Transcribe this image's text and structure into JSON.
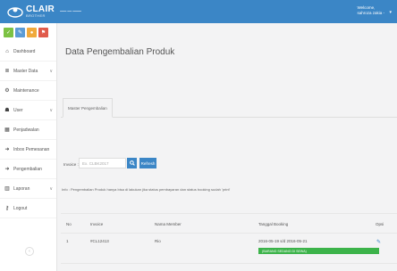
{
  "brand": {
    "name": "CLAIR",
    "sub": "BROTHER",
    "tagline": "━━━ ━━ ━━━━"
  },
  "user": {
    "welcome": "Welcome,",
    "name": "sahroza zakia -"
  },
  "colors": {
    "primary": "#3b86c6",
    "green": "#7cc243",
    "orange": "#f0a93b",
    "red": "#e05b4b",
    "status": "#3cb34a"
  },
  "shortcuts": [
    {
      "icon": "check-icon",
      "glyph": "✓",
      "color": "#7cc243"
    },
    {
      "icon": "pencil-icon",
      "glyph": "✎",
      "color": "#5b9bd5"
    },
    {
      "icon": "user-icon",
      "glyph": "●",
      "color": "#f0a93b"
    },
    {
      "icon": "flag-icon",
      "glyph": "⚑",
      "color": "#e05b4b"
    }
  ],
  "menu": [
    {
      "label": "Dashboard",
      "icon": "home-icon",
      "glyph": "⌂",
      "chevron": ""
    },
    {
      "label": "Master Data",
      "icon": "list-icon",
      "glyph": "≣",
      "chevron": "∨"
    },
    {
      "label": "Maintenance",
      "icon": "cogs-icon",
      "glyph": "⚙",
      "chevron": ""
    },
    {
      "label": "User",
      "icon": "users-icon",
      "glyph": "☗",
      "chevron": "∨"
    },
    {
      "label": "Penjadwalan",
      "icon": "calendar-icon",
      "glyph": "▦",
      "chevron": ""
    },
    {
      "label": "Inbox Pemesanan",
      "icon": "arrow-right-icon",
      "glyph": "➜",
      "chevron": ""
    },
    {
      "label": "Pengembalian",
      "icon": "arrow-right-icon",
      "glyph": "➜",
      "chevron": ""
    },
    {
      "label": "Laporan",
      "icon": "grid-icon",
      "glyph": "▥",
      "chevron": "∨"
    },
    {
      "label": "Logout",
      "icon": "key-icon",
      "glyph": "⚷",
      "chevron": ""
    }
  ],
  "page": {
    "title": "Data Pengembalian Produk",
    "tab": "Master Pengembalian",
    "invoice_label": "Invoice :",
    "invoice_placeholder": "Ex. CLBK2017",
    "search_glyph": "🔍",
    "refresh_label": "Refresh",
    "info": "Info : Pengembalian Produk hanya bisa di lakukan jika status pembayaran dan status booking sudah 'print'"
  },
  "table": {
    "headers": [
      "No",
      "Invoice",
      "Nama Member",
      "Tanggal Booking",
      "Opsi"
    ],
    "rows": [
      {
        "no": "1",
        "invoice": "#CL12413",
        "member": "Rio",
        "date": "2016-05-19 s/d 2016-05-21",
        "status": "(BARANG SEDANG DI SEWA)"
      }
    ]
  }
}
